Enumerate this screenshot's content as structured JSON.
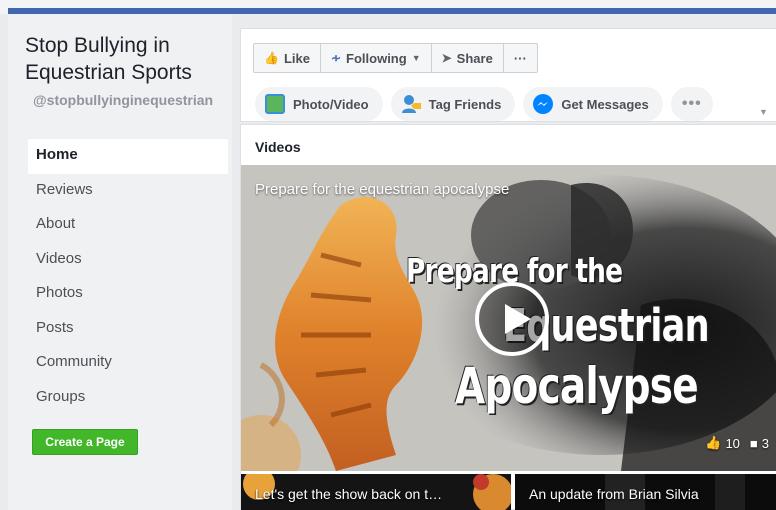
{
  "page": {
    "name": "Stop Bullying in Equestrian Sports",
    "handle": "@stopbullyinginequestrian"
  },
  "nav": {
    "items": [
      "Home",
      "Reviews",
      "About",
      "Videos",
      "Photos",
      "Posts",
      "Community",
      "Groups"
    ],
    "active": "Home"
  },
  "create_page_label": "Create a Page",
  "actions": {
    "like": "Like",
    "following": "Following",
    "share": "Share",
    "more": "···"
  },
  "composer": {
    "photo_video": "Photo/Video",
    "tag_friends": "Tag Friends",
    "get_messages": "Get Messages",
    "more": "•••"
  },
  "videos": {
    "section_title": "Videos",
    "featured": {
      "caption": "Prepare for the equestrian apocalypse",
      "poster_line1": "Prepare for the",
      "poster_line2": "Equestrian",
      "poster_line3": "Apocalypse",
      "likes": "10",
      "comments": "3"
    },
    "thumbs": [
      {
        "caption": "Let's get the show back on t…"
      },
      {
        "caption": "An update from Brian Silvia"
      }
    ]
  },
  "colors": {
    "brand_blue": "#4267b2",
    "create_green": "#42b72a",
    "messenger_blue": "#0084ff"
  },
  "icons": [
    "like-icon",
    "rss-icon",
    "share-icon",
    "photo-icon",
    "tag-friends-icon",
    "messenger-icon",
    "play-icon",
    "comment-icon"
  ]
}
